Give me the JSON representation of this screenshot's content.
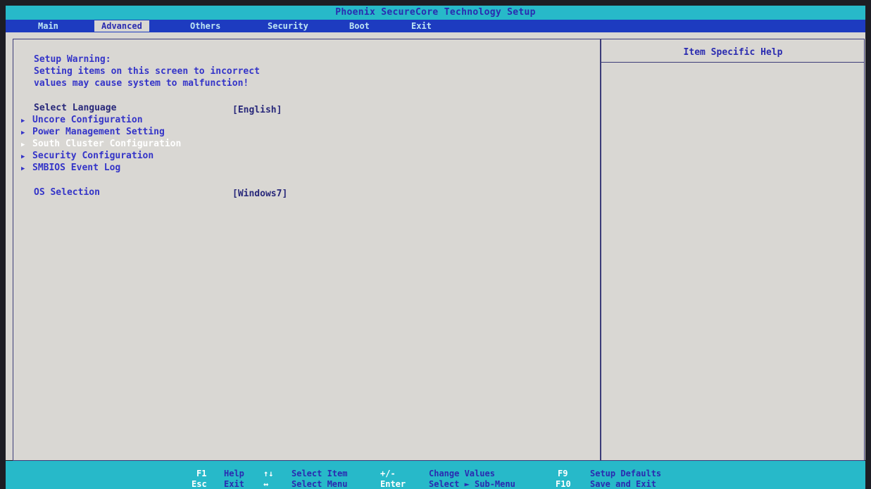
{
  "window": {
    "title": "Phoenix SecureCore Technology Setup"
  },
  "tabs": [
    {
      "label": "Main",
      "active": false
    },
    {
      "label": "Advanced",
      "active": true
    },
    {
      "label": "Others",
      "active": false
    },
    {
      "label": "Security",
      "active": false
    },
    {
      "label": "Boot",
      "active": false
    },
    {
      "label": "Exit",
      "active": false
    }
  ],
  "warning": {
    "heading": "Setup Warning:",
    "line1": "Setting items on this screen to incorrect",
    "line2": "values may cause system to malfunction!"
  },
  "settings": {
    "language": {
      "label": "Select Language",
      "value": "[English]"
    },
    "os": {
      "label": "OS Selection",
      "value": "[Windows7]"
    }
  },
  "submenus": [
    {
      "label": "Uncore Configuration",
      "selected": false
    },
    {
      "label": "Power Management Setting",
      "selected": false
    },
    {
      "label": "South Cluster Configuration",
      "selected": true
    },
    {
      "label": "Security Configuration",
      "selected": false
    },
    {
      "label": "SMBIOS Event Log",
      "selected": false
    }
  ],
  "help_panel": {
    "title": "Item Specific Help"
  },
  "keys": {
    "f1": "F1",
    "help": "Help",
    "esc": "Esc",
    "exit": "Exit",
    "updown": "↑↓",
    "select_item": "Select Item",
    "leftright": "↔",
    "select_menu": "Select Menu",
    "plusminus": "+/-",
    "change_values": "Change Values",
    "enter": "Enter",
    "select_submenu": "Select ► Sub-Menu",
    "f9": "F9",
    "setup_defaults": "Setup Defaults",
    "f10": "F10",
    "save_exit": "Save and Exit"
  },
  "colors": {
    "title_bar": "#27b9c9",
    "tab_bar": "#1d3bc0",
    "panel": "#d9d7d3",
    "text_blue": "#3434c8",
    "highlight": "#ffffff"
  }
}
